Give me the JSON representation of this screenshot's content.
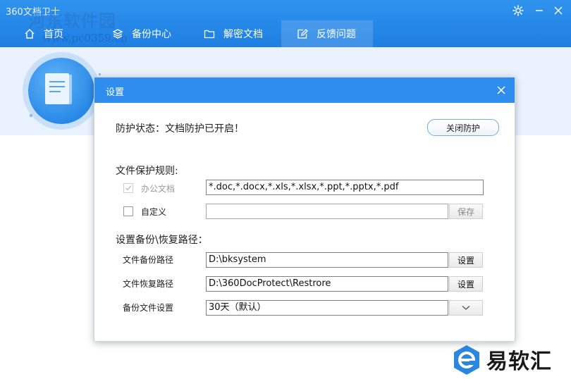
{
  "app": {
    "title": "360文档卫士",
    "watermark_line1": "河东软件园",
    "watermark_line2": "www.pc0359.cn"
  },
  "nav": {
    "tabs": [
      {
        "label": "首页",
        "icon": "home-icon"
      },
      {
        "label": "备份中心",
        "icon": "layers-icon"
      },
      {
        "label": "解密文档",
        "icon": "folder-icon"
      },
      {
        "label": "反馈问题",
        "icon": "edit-icon",
        "active": true
      }
    ]
  },
  "window": {
    "settings_icon": "gear-icon",
    "close_icon": "close-icon"
  },
  "dialog": {
    "title": "设置",
    "status": "防护状态：文档防护已开启！",
    "close_protection": "关闭防护",
    "rules_heading": "文件保护规则:",
    "office_docs": {
      "label": "办公文档",
      "checked": true,
      "value": "*.doc,*.docx,*.xls,*.xlsx,*.ppt,*.pptx,*.pdf"
    },
    "custom": {
      "label": "自定义",
      "checked": false,
      "value": "",
      "save_label": "保存"
    },
    "paths_heading": "设置备份\\恢复路径：",
    "backup_path": {
      "label": "文件备份路径",
      "value": "D:\\bksystem",
      "button": "设置"
    },
    "restore_path": {
      "label": "文件恢复路径",
      "value": "D:\\360DocProtect\\Restrore",
      "button": "设置"
    },
    "backup_setting": {
      "label": "备份文件设置",
      "value": "30天（默认）"
    }
  },
  "logo": {
    "text": "易软汇"
  },
  "colors": {
    "accent": "#2e8ded",
    "header": "#2f93ee",
    "hero": "#eaf3fd"
  }
}
